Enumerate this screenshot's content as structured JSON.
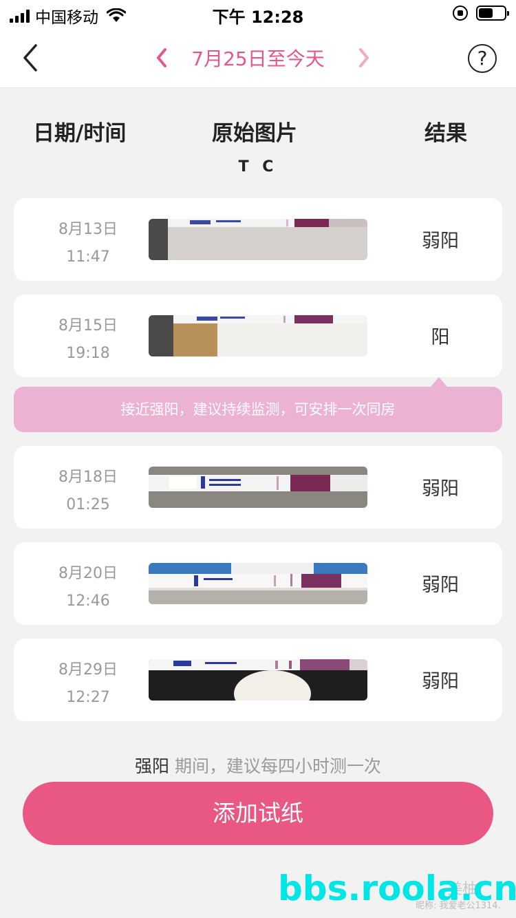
{
  "status_bar": {
    "carrier": "中国移动",
    "time": "下午 12:28",
    "battery_level": 0.55
  },
  "nav": {
    "date_range": "7月25日至今天",
    "accent_color": "#e5568b",
    "help_label": "?"
  },
  "table_header": {
    "date_time": "日期/时间",
    "original_image": "原始图片",
    "result": "结果",
    "tc_label": "T C"
  },
  "records": [
    {
      "date": "8月13日",
      "time": "11:47",
      "result": "弱阳"
    },
    {
      "date": "8月15日",
      "time": "19:18",
      "result": "阳"
    },
    {
      "date": "8月18日",
      "time": "01:25",
      "result": "弱阳"
    },
    {
      "date": "8月20日",
      "time": "12:46",
      "result": "弱阳"
    },
    {
      "date": "8月29日",
      "time": "12:27",
      "result": "弱阳"
    }
  ],
  "tip": {
    "text": "接近强阳，建议持续监测，可安排一次同房",
    "background": "#ecb2d4"
  },
  "advice": {
    "highlight": "强阳",
    "text": " 期间，建议每四小时测一次"
  },
  "add_button": {
    "label": "添加试纸",
    "color": "#e95785"
  },
  "watermark": {
    "site": "bbs.roola.cn",
    "logo_text": "美柚",
    "nickname": "昵称: 我爱老公1314."
  }
}
